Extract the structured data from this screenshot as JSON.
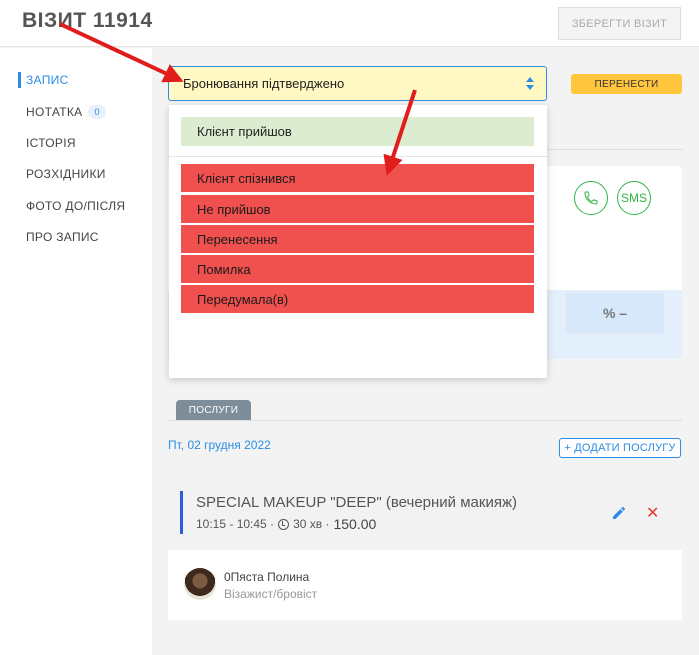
{
  "header": {
    "title": "ВІЗИТ 11914",
    "save_label": "ЗБЕРЕГТИ ВІЗИТ"
  },
  "sidebar": {
    "items": [
      {
        "label": "ЗАПИС",
        "active": true
      },
      {
        "label": "НОТАТКА",
        "badge": "0"
      },
      {
        "label": "ІСТОРІЯ"
      },
      {
        "label": "РОЗХІДНИКИ"
      },
      {
        "label": "ФОТО ДО/ПІСЛЯ"
      },
      {
        "label": "ПРО ЗАПИС"
      }
    ]
  },
  "status": {
    "selected": "Бронювання підтверджено",
    "reschedule_label": "ПЕРЕНЕСТИ",
    "options": [
      {
        "label": "Клієнт прийшов",
        "color": "green"
      },
      {
        "label": "Клієнт спізнився",
        "color": "red"
      },
      {
        "label": "Не прийшов",
        "color": "red"
      },
      {
        "label": "Перенесення",
        "color": "red"
      },
      {
        "label": "Помилка",
        "color": "red"
      },
      {
        "label": "Передумала(в)",
        "color": "red"
      }
    ]
  },
  "client": {
    "sms_label": "SMS",
    "stat_value": "% –"
  },
  "services": {
    "tab_label": "ПОСЛУГИ",
    "date": "Пт, 02 грудня 2022",
    "add_label": "+ ДОДАТИ ПОСЛУГУ",
    "item": {
      "name": "SPECIAL MAKEUP \"DEEP\" (вечерний макияж)",
      "time": "10:15 - 10:45 ·",
      "duration": "30 хв ·",
      "price": "150.00",
      "master_name": "0Пяста Полина",
      "master_role": "Візажист/бровіст"
    }
  },
  "colors": {
    "accent": "#2b8de4",
    "select_bg": "#fff8c2",
    "reschedule": "#ffc53d",
    "option_green": "#dcecd0",
    "option_red": "#f0514f",
    "phone_sms": "#2fb545",
    "annotation_arrow": "#e01c1c"
  }
}
